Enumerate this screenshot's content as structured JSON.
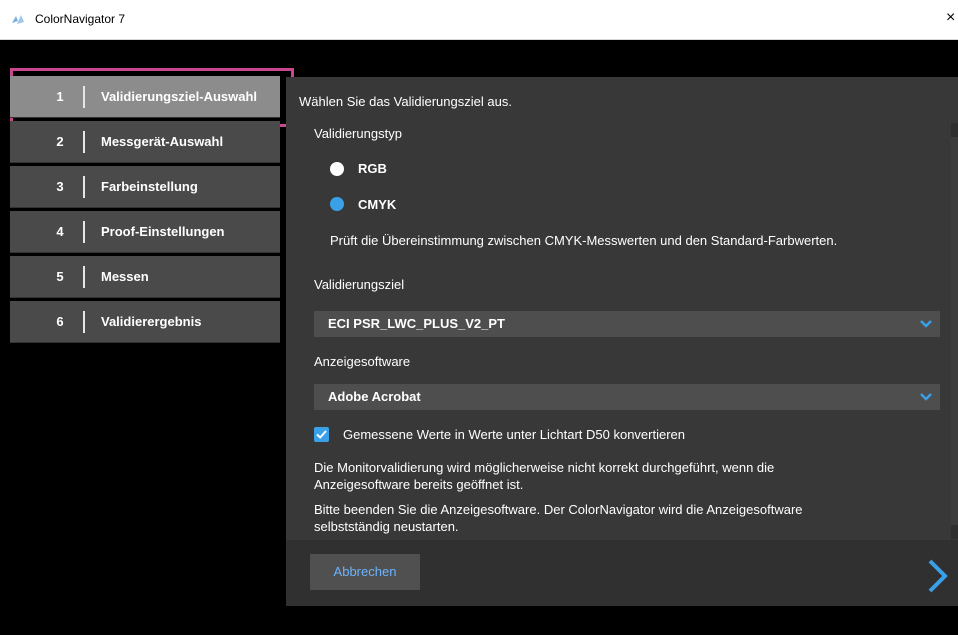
{
  "window": {
    "title": "ColorNavigator 7",
    "close_glyph": "×"
  },
  "steps": [
    {
      "num": "1",
      "label": "Validierungsziel-Auswahl",
      "active": true
    },
    {
      "num": "2",
      "label": "Messgerät-Auswahl"
    },
    {
      "num": "3",
      "label": "Farbeinstellung"
    },
    {
      "num": "4",
      "label": "Proof-Einstellungen"
    },
    {
      "num": "5",
      "label": "Messen"
    },
    {
      "num": "6",
      "label": "Validierergebnis"
    }
  ],
  "main": {
    "heading": "Wählen Sie das Validierungsziel aus.",
    "type_label": "Validierungstyp",
    "radio_rgb": "RGB",
    "radio_cmyk": "CMYK",
    "selected_type": "CMYK",
    "cmyk_note": "Prüft die Übereinstimmung zwischen CMYK-Messwerten und den Standard-Farbwerten.",
    "target_label": "Validierungsziel",
    "target_value": "ECI PSR_LWC_PLUS_V2_PT",
    "software_label": "Anzeigesoftware",
    "software_value": "Adobe Acrobat",
    "convert_checkbox": "Gemessene Werte in Werte unter Lichtart D50 konvertieren",
    "convert_checked": true,
    "info_lines": [
      "Die Monitorvalidierung wird möglicherweise nicht korrekt durchgeführt, wenn die",
      "Anzeigesoftware bereits geöffnet ist.",
      "Bitte beenden Sie die Anzeigesoftware. Der ColorNavigator wird die Anzeigesoftware",
      "selbstständig neustarten."
    ]
  },
  "footer": {
    "cancel_label": "Abbrechen"
  },
  "colors": {
    "accent": "#3aa0e8",
    "highlight": "#c8478f",
    "panel": "#383838"
  }
}
